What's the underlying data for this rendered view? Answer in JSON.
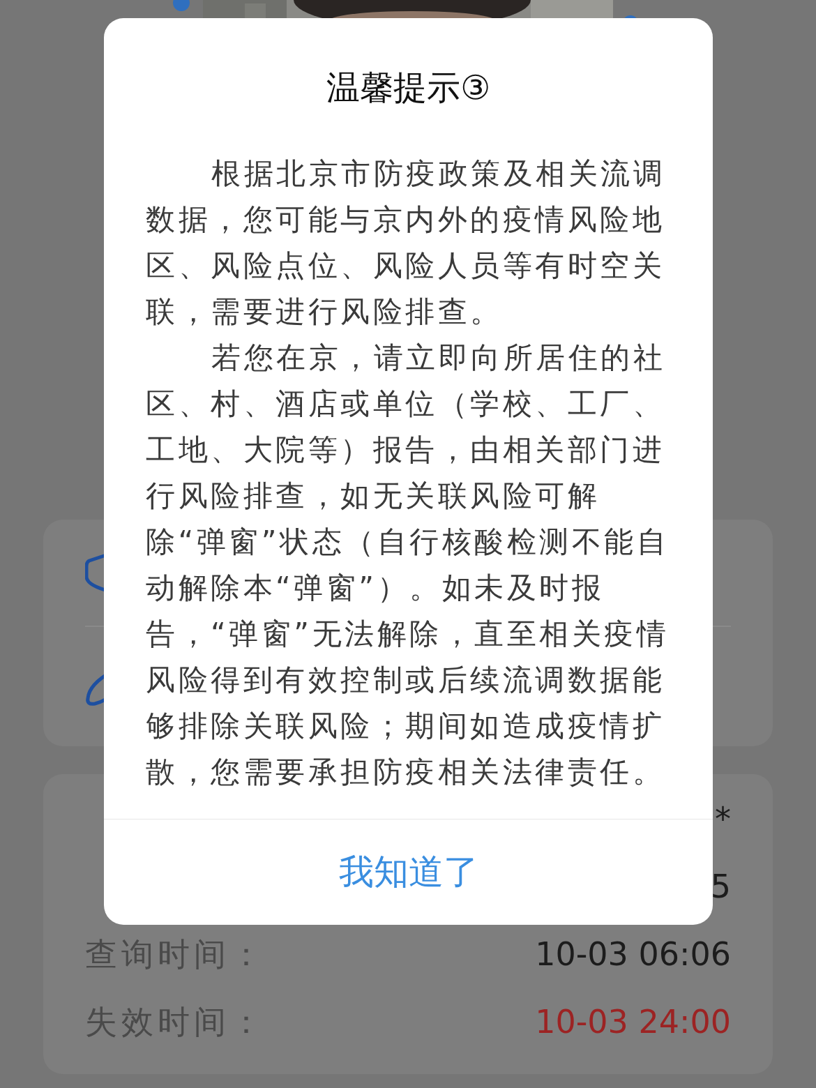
{
  "background": {
    "info_rows": [
      {
        "label": "",
        "value": "*",
        "kind": "plain"
      },
      {
        "label": "",
        "value": "5",
        "kind": "plain"
      },
      {
        "label": "查询时间：",
        "value": "10-03 06:06",
        "kind": "plain"
      },
      {
        "label": "失效时间：",
        "value": "10-03 24:00",
        "kind": "expiry"
      }
    ]
  },
  "dialog": {
    "title": "温馨提示③",
    "paragraphs": [
      "根据北京市防疫政策及相关流调数据，您可能与京内外的疫情风险地区、风险点位、风险人员等有时空关联，需要进行风险排查。",
      "若您在京，请立即向所居住的社区、村、酒店或单位（学校、工厂、工地、大院等）报告，由相关部门进行风险排查，如无关联风险可解除“弹窗”状态（自行核酸检测不能自动解除本“弹窗”）。如未及时报告，“弹窗”无法解除，直至相关疫情风险得到有效控制或后续流调数据能够排除关联风险；期间如造成疫情扩散，您需要承担防疫相关法律责任。"
    ],
    "button": "我知道了"
  }
}
